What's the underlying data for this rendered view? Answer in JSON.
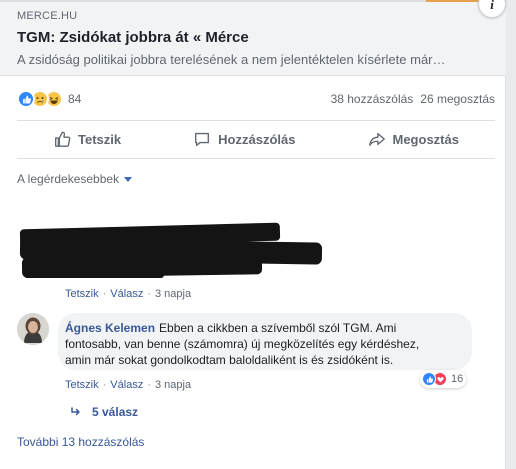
{
  "link_preview": {
    "domain": "MERCE.HU",
    "title": "TGM: Zsidókat jobbra át « Mérce",
    "description": "A zsidóság politikai jobbra terelésének a nem jelentéktelen kísérlete már…"
  },
  "reactions": {
    "count": "84",
    "types": [
      "like-icon",
      "sad-icon",
      "haha-icon"
    ]
  },
  "stats": {
    "comments": "38 hozzászólás",
    "shares": "26 megosztás"
  },
  "actions": {
    "like": "Tetszik",
    "comment": "Hozzászólás",
    "share": "Megosztás"
  },
  "sort": {
    "label": "A legérdekesebbek"
  },
  "comment1": {
    "like": "Tetszik",
    "reply": "Válasz",
    "time": "3 napja"
  },
  "comment2": {
    "author": "Ágnes Kelemen",
    "line1": "Ebben a cikkben a szívemből szól TGM. Ami",
    "line2": "fontosabb, van benne (számomra) új megközelítés egy kérdéshez,",
    "line3": "amin már sokat gondolkodtam baloldaliként is és zsidóként is.",
    "like": "Tetszik",
    "reply": "Válasz",
    "time": "3 napja",
    "reaction_count": "16"
  },
  "replies": {
    "label": "5 válasz"
  },
  "more_comments": {
    "label": "További 13 hozzászólás"
  },
  "colors": {
    "link": "#385898",
    "like_blue": "#2d88ff",
    "love_red": "#f33e58",
    "muted": "#606770"
  }
}
